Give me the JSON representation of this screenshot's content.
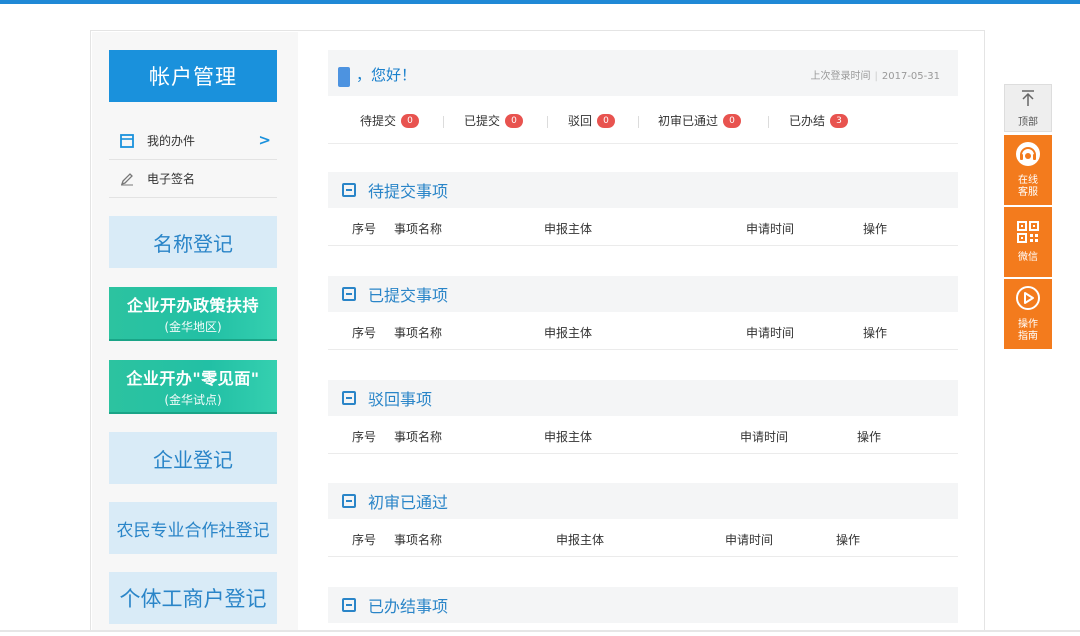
{
  "sidebar": {
    "account_title": "帐户管理",
    "items": [
      {
        "label": "我的办件",
        "icon": "document-icon",
        "arrow": ">"
      },
      {
        "label": "电子签名",
        "icon": "pen-icon"
      }
    ],
    "name_registration": "名称登记",
    "promo1": {
      "title": "企业开办政策扶持",
      "sub": "(金华地区)"
    },
    "promo2": {
      "title": "企业开办\"零见面\"",
      "sub": "(金华试点)"
    },
    "enterprise_registration": "企业登记",
    "coop_registration": "农民专业合作社登记",
    "individual_registration": "个体工商户登记"
  },
  "greeting": {
    "hello": "，您好！",
    "last_login_label": "上次登录时间",
    "separator": "|",
    "last_login_date": "2017-05-31"
  },
  "stats": [
    {
      "label": "待提交",
      "count": "0"
    },
    {
      "label": "已提交",
      "count": "0"
    },
    {
      "label": "驳回",
      "count": "0"
    },
    {
      "label": "初审已通过",
      "count": "0"
    },
    {
      "label": "已办结",
      "count": "3"
    }
  ],
  "sections": [
    {
      "title": "待提交事项",
      "cols": [
        "序号",
        "事项名称",
        "申报主体",
        "申请时间",
        "操作"
      ]
    },
    {
      "title": "已提交事项",
      "cols": [
        "序号",
        "事项名称",
        "申报主体",
        "申请时间",
        "操作"
      ]
    },
    {
      "title": "驳回事项",
      "cols": [
        "序号",
        "事项名称",
        "申报主体",
        "申请时间",
        "操作"
      ]
    },
    {
      "title": "初审已通过",
      "cols": [
        "序号",
        "事项名称",
        "申报主体",
        "申请时间",
        "操作"
      ]
    },
    {
      "title": "已办结事项"
    }
  ],
  "right_toolbar": {
    "top": {
      "label": "顶部",
      "icon": "arrow-up-icon"
    },
    "buttons": [
      {
        "label": "在线客服",
        "icon": "headset-icon"
      },
      {
        "label": "微信",
        "icon": "qr-code-icon"
      },
      {
        "label": "操作指南",
        "icon": "play-icon"
      }
    ]
  },
  "colors": {
    "brand_blue": "#1a91dc",
    "accent_green": "#22c0a5",
    "toolbar_orange": "#f37b1d",
    "badge_red": "#e8534f"
  }
}
